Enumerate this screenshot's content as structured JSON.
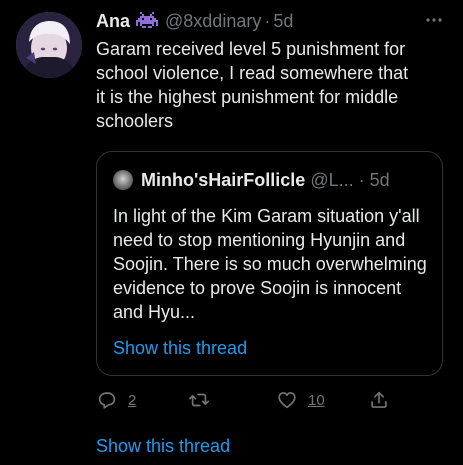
{
  "tweet": {
    "author_name": "Ana",
    "handle": "@8xddinary",
    "separator": "·",
    "time": "5d",
    "author_emoji": "alien-monster",
    "text": "Garam received level 5 punishment for\nschool violence, I read somewhere that\nit is the highest punishment for middle\nschoolers"
  },
  "quote": {
    "author_name": "Minho'sHairFollicle",
    "handle": "@L...",
    "separator": "·",
    "time": "5d",
    "text": "In light of the Kim Garam situation y'all need to stop mentioning Hyunjin and Soojin. There is so much overwhelming evidence to prove Soojin is innocent and Hyu...",
    "show_thread": "Show this thread"
  },
  "actions": {
    "reply_count": "2",
    "retweet_count": "",
    "like_count": "10"
  },
  "show_thread": "Show this thread",
  "colors": {
    "background": "#000000",
    "text": "#e7e9ea",
    "secondary": "#71767b",
    "accent": "#1d9bf0",
    "border": "#2f3336",
    "emoji": "#8e6fd8"
  }
}
